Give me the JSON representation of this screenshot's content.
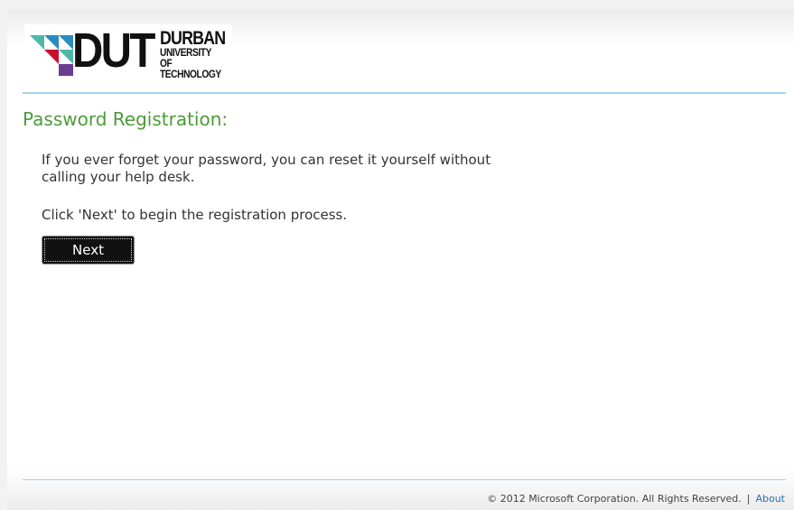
{
  "logo": {
    "mark": "DUT",
    "line1": "DURBAN",
    "line2": "UNIVERSITY OF",
    "line3": "TECHNOLOGY",
    "colors": [
      "#4db8a8",
      "#2a8bbf",
      "#c8102e",
      "#6a3d8f"
    ]
  },
  "main": {
    "title": "Password Registration:",
    "description": "If you ever forget your password, you can reset it yourself without calling your help desk.",
    "instruction": "Click 'Next' to begin the registration process.",
    "next_label": "Next"
  },
  "footer": {
    "copyright": "© 2012 Microsoft Corporation. All Rights Reserved.",
    "separator": "|",
    "about_label": "About"
  },
  "colors": {
    "title": "#4e9a3a",
    "rule": "#a6d3ea",
    "link": "#2b6fb6",
    "button": "#111111"
  }
}
